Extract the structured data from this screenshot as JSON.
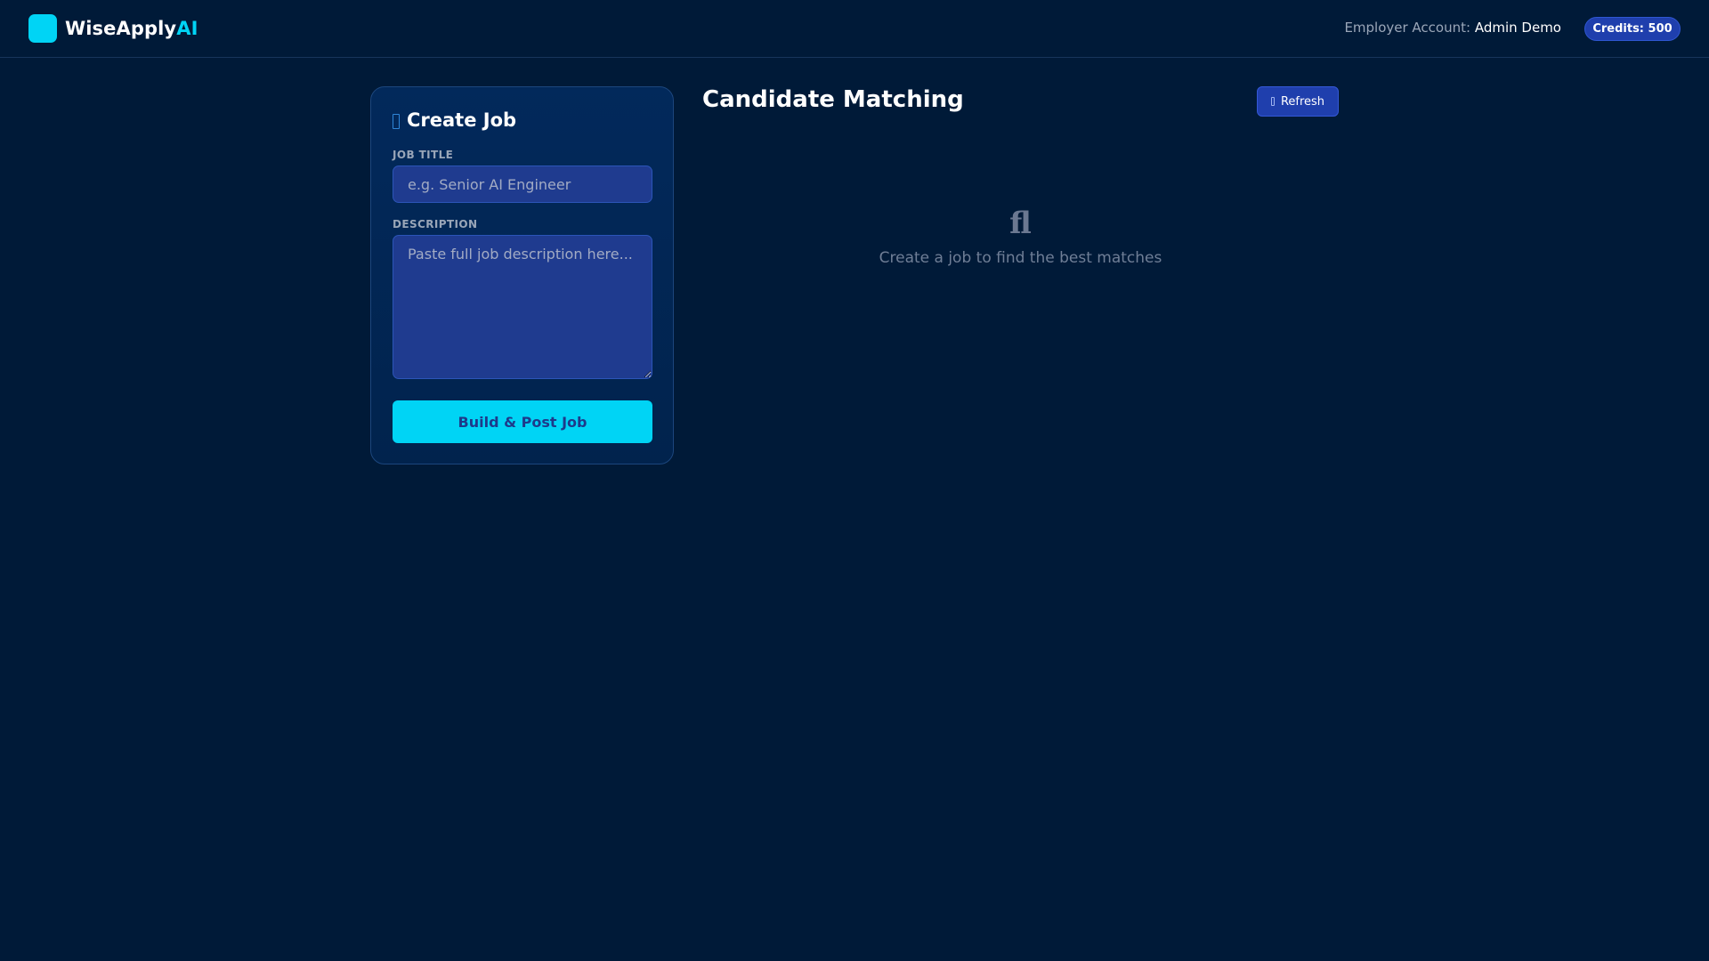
{
  "header": {
    "brand_name": "WiseApply",
    "brand_accent": "AI",
    "account_label": "Employer Account:",
    "account_name": "Admin Demo",
    "credits": "Credits: 500"
  },
  "create_job": {
    "title": "Create Job",
    "icon": "plus-icon",
    "job_title_label": "JOB TITLE",
    "job_title_placeholder": "e.g. Senior AI Engineer",
    "job_title_value": "",
    "description_label": "DESCRIPTION",
    "description_placeholder": "Paste full job description here...",
    "description_value": "",
    "submit_label": "Build & Post Job"
  },
  "matching": {
    "title": "Candidate Matching",
    "refresh_label": "Refresh",
    "refresh_icon": "refresh-icon",
    "empty_icon_glyph": "ﬂ",
    "empty_text": "Create a job to find the best matches"
  },
  "colors": {
    "background": "#001a38",
    "accent": "#00d4f5",
    "primary_button": "#1f3fad",
    "panel": "#02295b"
  }
}
